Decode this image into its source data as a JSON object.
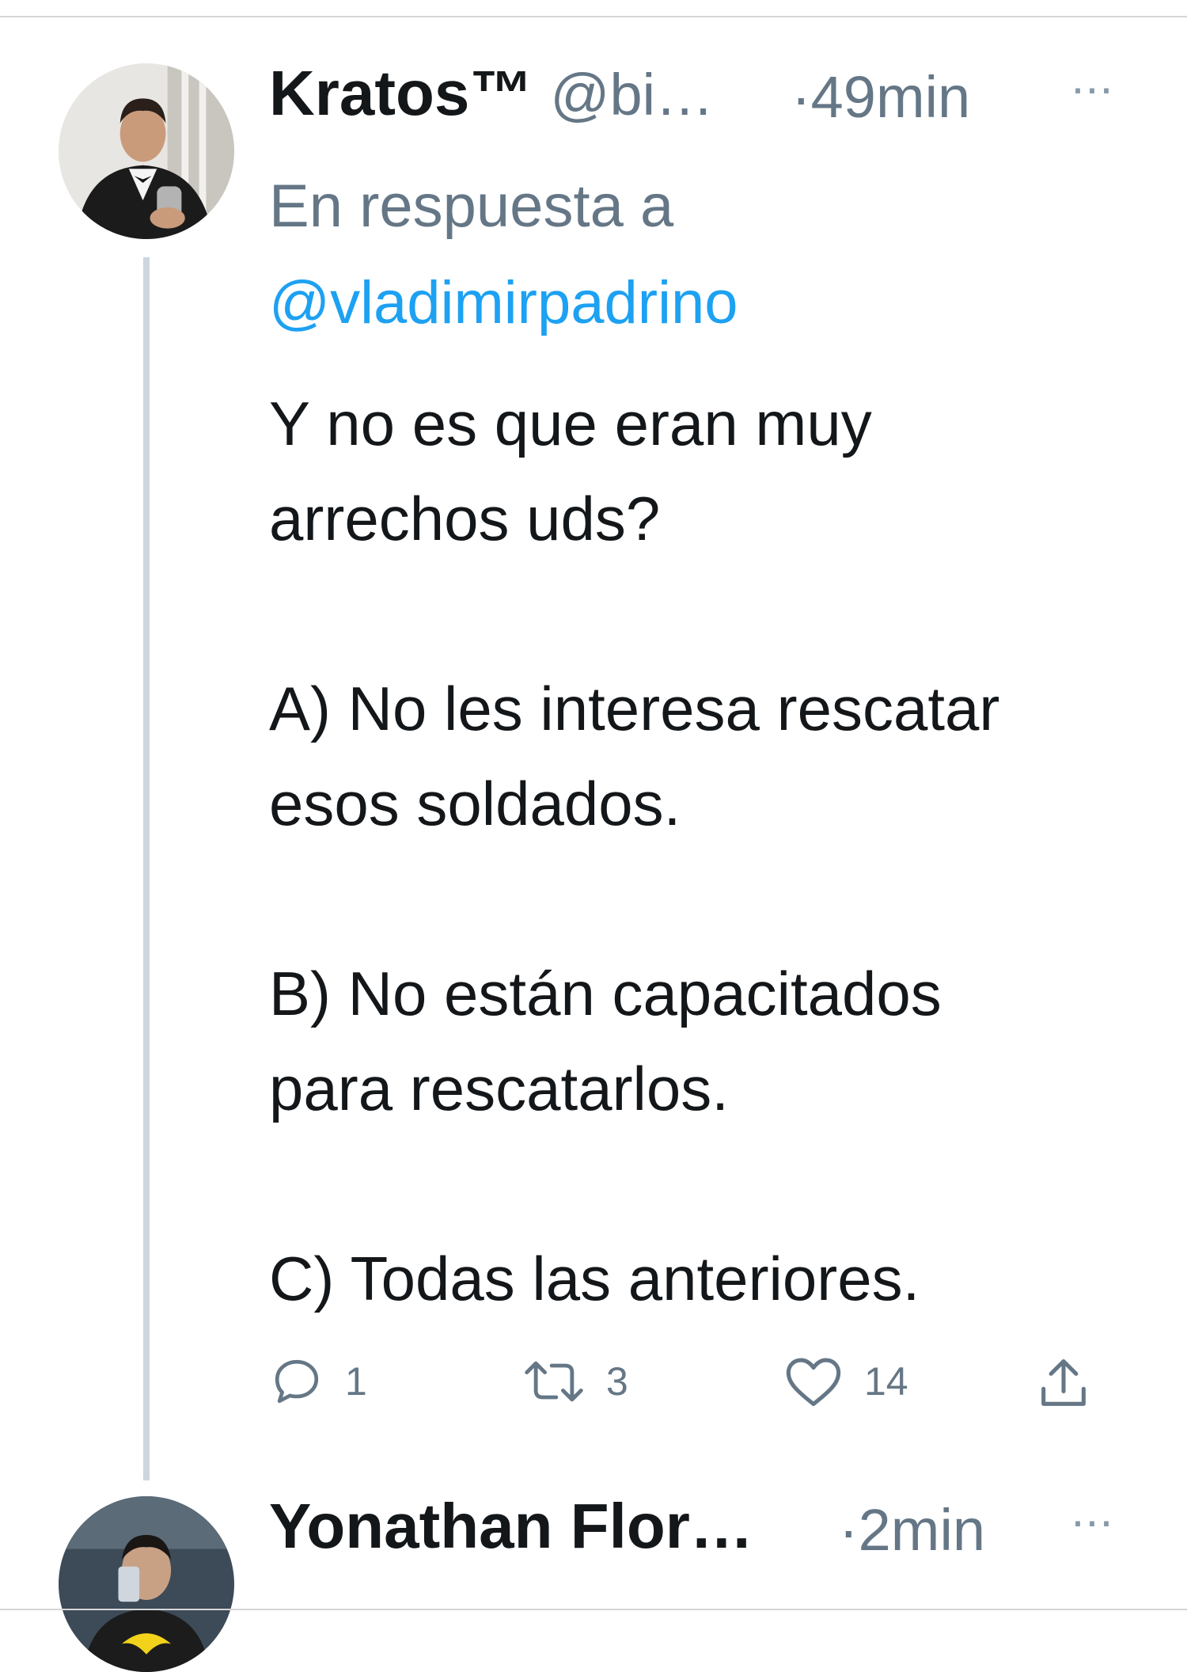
{
  "tweet": {
    "author_name": "Kratos™",
    "author_handle": "@bi…",
    "time": "·49min",
    "more_icon": "···",
    "reply_label": "En respuesta a",
    "reply_mention": "@vladimirpadrino",
    "text_lines": [
      "Y no es que eran muy",
      "arrechos uds?",
      "A) No les interesa rescatar",
      "esos soldados.",
      "B) No están capacitados",
      "para rescatarlos.",
      "C) Todas las anteriores."
    ],
    "actions": {
      "reply_count": "1",
      "retweet_count": "3",
      "like_count": "14"
    }
  },
  "next_tweet": {
    "author_name": "Yonathan Flor…",
    "time": "·2min",
    "more_icon": "···"
  },
  "colors": {
    "text": "#14171a",
    "secondary": "#657786",
    "link": "#1da1f2",
    "thread_line": "#cdd6dd"
  }
}
